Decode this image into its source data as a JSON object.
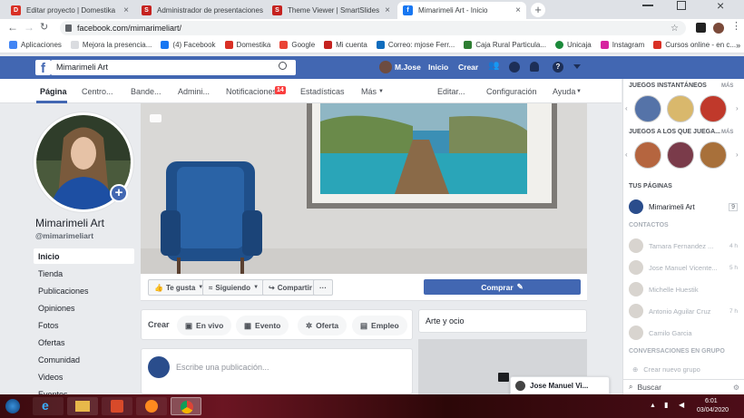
{
  "browser": {
    "tabs": [
      {
        "label": "Editar proyecto | Domestika",
        "color": "#d93025",
        "active": false
      },
      {
        "label": "Administrador de presentaciones",
        "color": "#c5221f",
        "active": false
      },
      {
        "label": "Theme Viewer | SmartSlides",
        "color": "#c5221f",
        "active": false
      },
      {
        "label": "Mimarimeli Art - Inicio",
        "color": "#1877f2",
        "active": true
      }
    ],
    "url": "facebook.com/mimarimeliart/",
    "bookmarks": [
      "Aplicaciones",
      "Mejora la presencia...",
      "(4) Facebook",
      "Domestika",
      "Google",
      "Mi cuenta",
      "Correo: mjose Ferr...",
      "Caja Rural Particula...",
      "Unicaja",
      "Instagram",
      "Cursos online - en c..."
    ]
  },
  "fb_header": {
    "search_value": "Mimarimeli Art",
    "user": "M.Jose",
    "home": "Inicio",
    "create": "Crear"
  },
  "page_nav": {
    "items": [
      "Página",
      "Centro...",
      "Bande...",
      "Admini...",
      "Notificaciones",
      "Estadísticas",
      "Más",
      "Editar...",
      "Configuración",
      "Ayuda"
    ],
    "notif_count": "14"
  },
  "left": {
    "page_name": "Mimarimeli Art",
    "handle": "@mimarimeliart",
    "nav": [
      "Inicio",
      "Tienda",
      "Publicaciones",
      "Opiniones",
      "Fotos",
      "Ofertas",
      "Comunidad",
      "Videos",
      "Eventos"
    ]
  },
  "actions": {
    "like": "Te gusta",
    "following": "Siguiendo",
    "share": "Compartir",
    "more": "···",
    "buy": "Comprar"
  },
  "create": {
    "label": "Crear",
    "buttons": [
      "En vivo",
      "Evento",
      "Oferta",
      "Empleo"
    ]
  },
  "composer_placeholder": "Escribe una publicación...",
  "side_card_title": "Arte y ocio",
  "chat_popup": "Jose Manuel Vi...",
  "right_sidebar": {
    "instant_games": "JUEGOS INSTANTÁNEOS",
    "friends_games": "JUEGOS A LOS QUE JUEGA...",
    "more": "MÁS",
    "your_pages": "TUS PÁGINAS",
    "page_item": "Mimarimeli Art",
    "page_badge": "9",
    "contacts": "CONTACTOS",
    "contact_list": [
      {
        "name": "Tamara Fernandez ...",
        "time": "4 h"
      },
      {
        "name": "Jose Manuel Vicente...",
        "time": "5 h"
      },
      {
        "name": "Michelle Huestik",
        "time": ""
      },
      {
        "name": "Antonio Aguilar Cruz",
        "time": "7 h"
      },
      {
        "name": "Camilo Garcia",
        "time": ""
      }
    ],
    "group_convos": "CONVERSACIONES EN GRUPO",
    "new_group": "Crear nuevo grupo",
    "search": "Buscar"
  },
  "taskbar": {
    "time": "6:01",
    "date": "03/04/2020"
  }
}
